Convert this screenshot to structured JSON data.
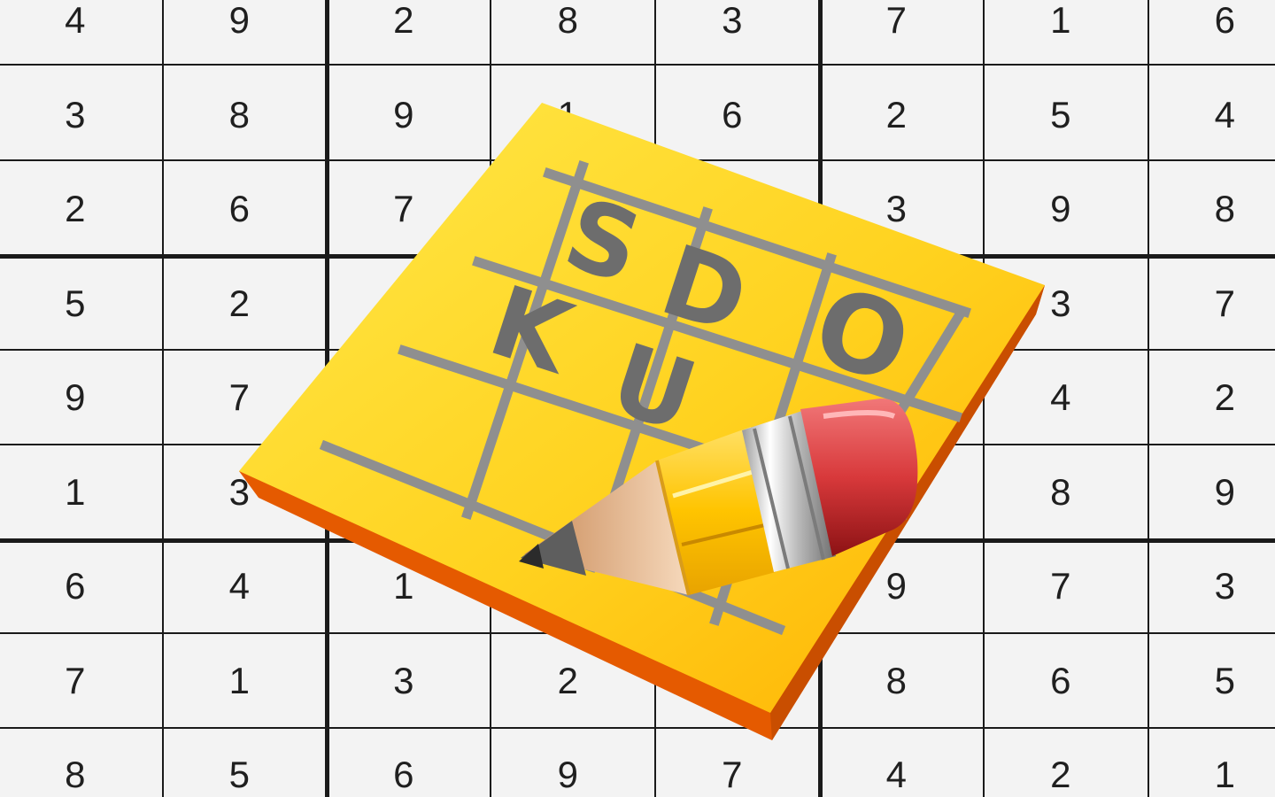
{
  "board": {
    "rows": [
      [
        "4",
        "9",
        "2",
        "8",
        "3",
        "7",
        "1",
        "6"
      ],
      [
        "3",
        "8",
        "9",
        "1",
        "6",
        "2",
        "5",
        "4"
      ],
      [
        "2",
        "6",
        "7",
        "",
        "",
        "3",
        "9",
        "8"
      ],
      [
        "5",
        "2",
        "",
        "",
        "",
        "",
        "3",
        "7"
      ],
      [
        "9",
        "7",
        "",
        "",
        "",
        "",
        "4",
        "2"
      ],
      [
        "1",
        "3",
        "",
        "",
        "",
        "",
        "8",
        "9"
      ],
      [
        "6",
        "4",
        "1",
        "",
        "",
        "9",
        "7",
        "3"
      ],
      [
        "7",
        "1",
        "3",
        "2",
        "",
        "8",
        "6",
        "5"
      ],
      [
        "8",
        "5",
        "6",
        "9",
        "7",
        "4",
        "2",
        "1"
      ]
    ]
  },
  "logo": {
    "letters": [
      "S",
      "D",
      "O",
      "K",
      "U"
    ],
    "colors": {
      "pad_light": "#ffe94a",
      "pad_dark": "#ffb000",
      "pad_edge": "#e55a00",
      "grid_lines": "#8f8f8f",
      "letters": "#6d6d6d",
      "eraser": "#d8393b",
      "pencil_body": "#ffd21f"
    }
  },
  "icons": {
    "pencil": "pencil-icon"
  }
}
